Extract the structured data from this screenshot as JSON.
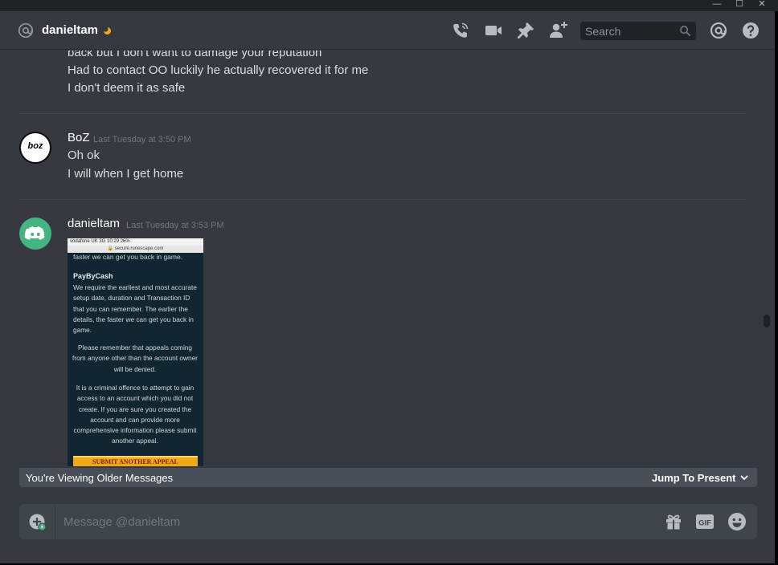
{
  "window": {
    "minimize_glyph": "—",
    "maximize_glyph": "☐",
    "close_glyph": "✕"
  },
  "header": {
    "channel_icon": "at-icon",
    "username": "danieltam",
    "status_icon": "idle-moon-icon",
    "icons": [
      "call-icon",
      "video-icon",
      "pin-icon",
      "add-friend-icon",
      "mentions-icon",
      "help-icon"
    ],
    "search": {
      "placeholder": "Search",
      "icon": "search-icon"
    }
  },
  "messages": {
    "previous_lines": [
      "back but I don't want to damage your reputation",
      "Had to contact OO luckily he actually recovered it for me",
      "I don't deem it as safe"
    ],
    "boz": {
      "author": "BoZ",
      "timestamp": "Last Tuesday at 3:50 PM",
      "avatar_text": "boz",
      "lines": [
        "Oh ok",
        "I will when I get home"
      ]
    },
    "danieltam": {
      "author": "danieltam",
      "timestamp": "Last Tuesday at 3:53 PM",
      "avatar_icon": "discord-logo-icon",
      "attachment": {
        "status_bar": "vodafone UK  3G      10:29            26%",
        "url": "🔒 secure.runescape.com",
        "top_text": "faster we can get you back in game.",
        "heading": "PayByCash",
        "para1": "We require the earliest and most accurate setup date, duration and Transaction ID that you can remember. The earlier the details, the faster we can get you back in game.",
        "para2": "Please remember that appeals coming from anyone other than the account owner will be denied.",
        "para3": "It is a criminal offence to attempt to gain access to an account which you did not create. If you are sure you created the account and can provide more comprehensive information please submit another appeal.",
        "button": "SUBMIT ANOTHER APPEAL"
      }
    }
  },
  "older_bar": {
    "text": "You're Viewing Older Messages",
    "jump": "Jump To Present",
    "chevron_icon": "chevron-down-icon"
  },
  "composer": {
    "placeholder": "Message @danieltam",
    "icons": [
      "upload-plus-icon",
      "gift-icon",
      "gif-icon",
      "emoji-icon"
    ]
  },
  "colors": {
    "background": "#36393f",
    "header_text": "#ffffff",
    "message_text": "#dcddde",
    "timestamp": "#72767d",
    "discord_green": "#43b581",
    "idle": "#faa61a"
  }
}
